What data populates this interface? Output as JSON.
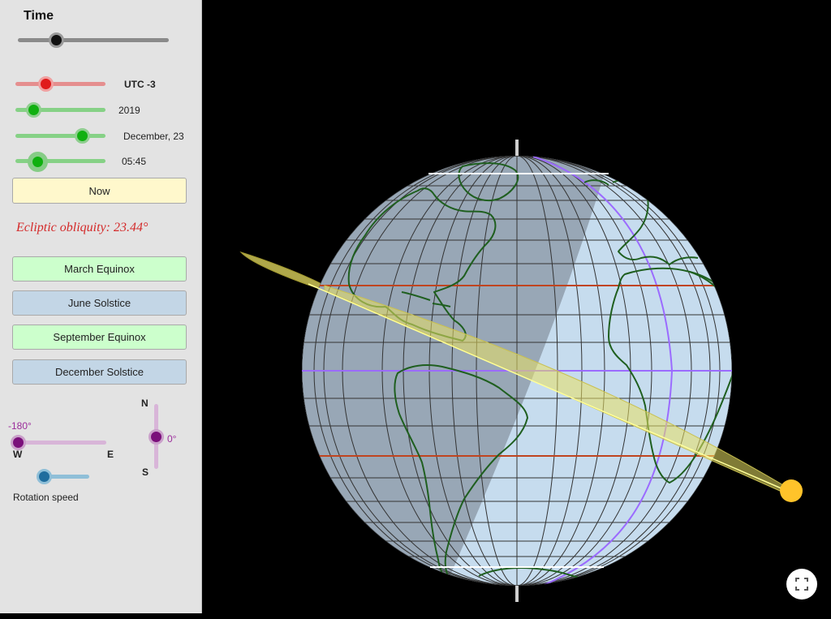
{
  "panel": {
    "time_title": "Time",
    "utc": {
      "label": "UTC -3"
    },
    "year": {
      "label": "2019"
    },
    "date": {
      "label": "December, 23"
    },
    "clock": {
      "label": "05:45"
    },
    "now_button": "Now",
    "obliquity": "Ecliptic obliquity: 23.44°",
    "buttons": {
      "march": "March Equinox",
      "june": "June Solstice",
      "september": "September Equinox",
      "december": "December Solstice"
    },
    "view": {
      "longitude_value": "-180°",
      "west": "W",
      "east": "E",
      "north": "N",
      "south": "S",
      "latitude_value": "0°"
    },
    "rotation_speed": "Rotation speed"
  },
  "colors": {
    "utc_slider": "#d9534f",
    "date_sliders": "#2ea82e",
    "view_slider": "#8b1a8b",
    "rotation_slider": "#2e86c1",
    "globe_ocean": "#c6dcee",
    "night_shade": "#8b99a6",
    "tropic_lines": "#c0441f",
    "equator_line": "#9b6bff",
    "terminator_meridian": "#9b6bff",
    "coastlines": "#1f5f1f",
    "ecliptic_plane": "#e9e063",
    "sun": "#ffc32a"
  },
  "icons": {
    "fullscreen": "fullscreen-icon"
  }
}
